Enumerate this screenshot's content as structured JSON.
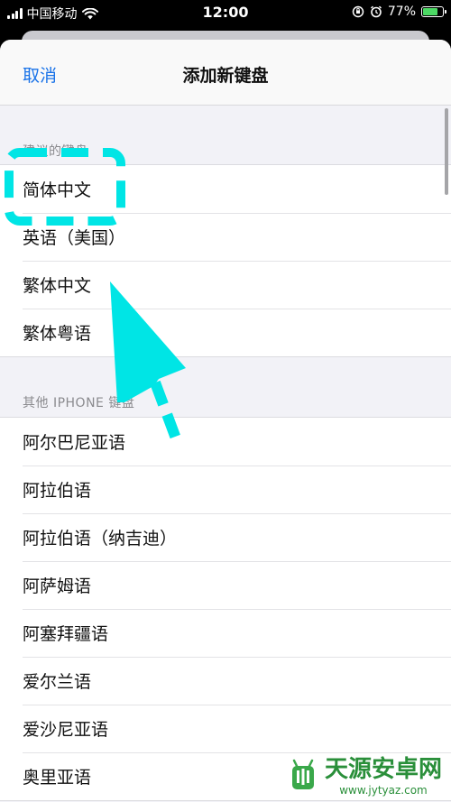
{
  "status_bar": {
    "carrier": "中国移动",
    "time": "12:00",
    "battery_percent": "77%",
    "battery_level": 0.77,
    "accent": "#4cd964"
  },
  "nav": {
    "cancel_label": "取消",
    "title": "添加新键盘"
  },
  "suggested": {
    "header": "建议的键盘",
    "items": [
      {
        "label": "简体中文"
      },
      {
        "label": "英语（美国）"
      },
      {
        "label": "繁体中文"
      },
      {
        "label": "繁体粤语"
      }
    ]
  },
  "other": {
    "header": "其他 IPHONE 键盘",
    "items": [
      {
        "label": "阿尔巴尼亚语"
      },
      {
        "label": "阿拉伯语"
      },
      {
        "label": "阿拉伯语（纳吉迪）"
      },
      {
        "label": "阿萨姆语"
      },
      {
        "label": "阿塞拜疆语"
      },
      {
        "label": "爱尔兰语"
      },
      {
        "label": "爱沙尼亚语"
      },
      {
        "label": "奥里亚语"
      }
    ]
  },
  "annotation": {
    "color": "#00e5e5"
  },
  "watermark": {
    "title": "天源安卓网",
    "url": "www.jytyaz.com"
  }
}
